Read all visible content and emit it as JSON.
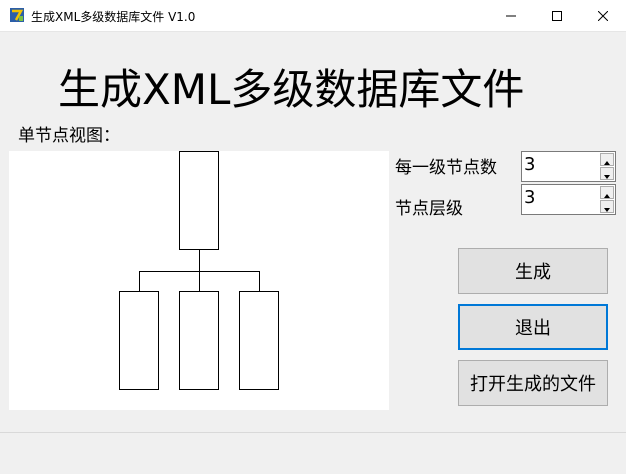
{
  "window": {
    "title": "生成XML多级数据库文件 V1.0",
    "controls": {
      "minimize": "minimize",
      "maximize": "maximize",
      "close": "close"
    }
  },
  "main": {
    "heading": "生成XML多级数据库文件",
    "diagram_label": "单节点视图：",
    "fields": [
      {
        "label": "每一级节点数",
        "value": "3"
      },
      {
        "label": "节点层级",
        "value": "3"
      }
    ],
    "buttons": {
      "generate": "生成",
      "exit": "退出",
      "open_file": "打开生成的文件"
    }
  },
  "diagram": {
    "node_count_per_level": 3,
    "levels_shown": 2
  },
  "colors": {
    "window_bg": "#f0f0f0",
    "titlebar_bg": "#ffffff",
    "focus_border": "#0078d7",
    "button_bg": "#e1e1e1"
  },
  "icons": {
    "app": "app-logo-icon",
    "minimize": "minimize-icon",
    "maximize": "maximize-icon",
    "close": "close-icon"
  }
}
